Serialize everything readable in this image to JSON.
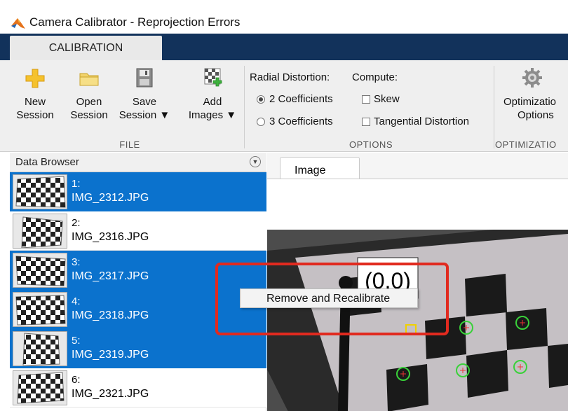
{
  "window": {
    "title": "Camera Calibrator - Reprojection Errors"
  },
  "tabs": {
    "calibration": "CALIBRATION"
  },
  "ribbon": {
    "file": {
      "new_line1": "New",
      "new_line2": "Session",
      "open_line1": "Open",
      "open_line2": "Session",
      "save_line1": "Save",
      "save_line2": "Session ▼",
      "add_line1": "Add",
      "add_line2": "Images ▼",
      "section": "FILE"
    },
    "options": {
      "radial_label": "Radial Distortion:",
      "compute_label": "Compute:",
      "coeff2": "2 Coefficients",
      "coeff3": "3 Coefficients",
      "skew": "Skew",
      "tangential": "Tangential Distortion",
      "section": "OPTIONS",
      "selected_radial": "2 Coefficients"
    },
    "optimization": {
      "btn_line1": "Optimizatio",
      "btn_line2": "Options",
      "section": "OPTIMIZATIO"
    }
  },
  "data_browser": {
    "title": "Data Browser",
    "items": [
      {
        "num": "1:",
        "file": "IMG_2312.JPG",
        "selected": true
      },
      {
        "num": "2:",
        "file": "IMG_2316.JPG",
        "selected": false
      },
      {
        "num": "3:",
        "file": "IMG_2317.JPG",
        "selected": true
      },
      {
        "num": "4:",
        "file": "IMG_2318.JPG",
        "selected": true
      },
      {
        "num": "5:",
        "file": "IMG_2319.JPG",
        "selected": true
      },
      {
        "num": "6:",
        "file": "IMG_2321.JPG",
        "selected": false
      }
    ]
  },
  "image_panel": {
    "tab": "Image",
    "origin_label": "(0,0)"
  },
  "context_menu": {
    "remove": "Remove and Recalibrate"
  },
  "colors": {
    "selection": "#0b72cd",
    "tab_strip": "#12325b",
    "highlight": "#e12a1f",
    "corner_marker": "#39d139"
  }
}
